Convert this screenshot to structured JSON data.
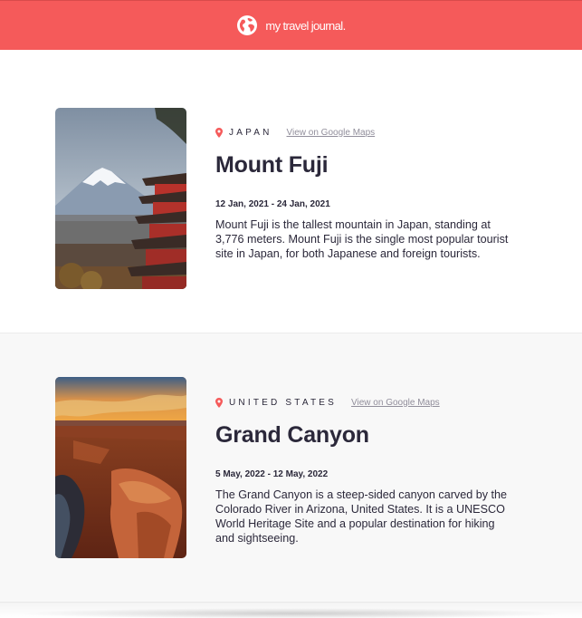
{
  "header": {
    "brand": "my travel journal.",
    "icon": "globe-icon",
    "color": "#f55a5a"
  },
  "entries": [
    {
      "country": "JAPAN",
      "maps_link": "View on Google Maps",
      "title": "Mount Fuji",
      "dates": "12 Jan, 2021 - 24 Jan, 2021",
      "description": "Mount Fuji is the tallest mountain in Japan, standing at 3,776 meters. Mount Fuji is the single most popular tourist site in Japan, for both Japanese and foreign tourists."
    },
    {
      "country": "UNITED STATES",
      "maps_link": "View on Google Maps",
      "title": "Grand Canyon",
      "dates": "5 May, 2022 - 12 May, 2022",
      "description": "The Grand Canyon is a steep-sided canyon carved by the Colorado River in Arizona, United States. It is a UNESCO World Heritage Site and a popular destination for hiking and sightseeing."
    }
  ]
}
